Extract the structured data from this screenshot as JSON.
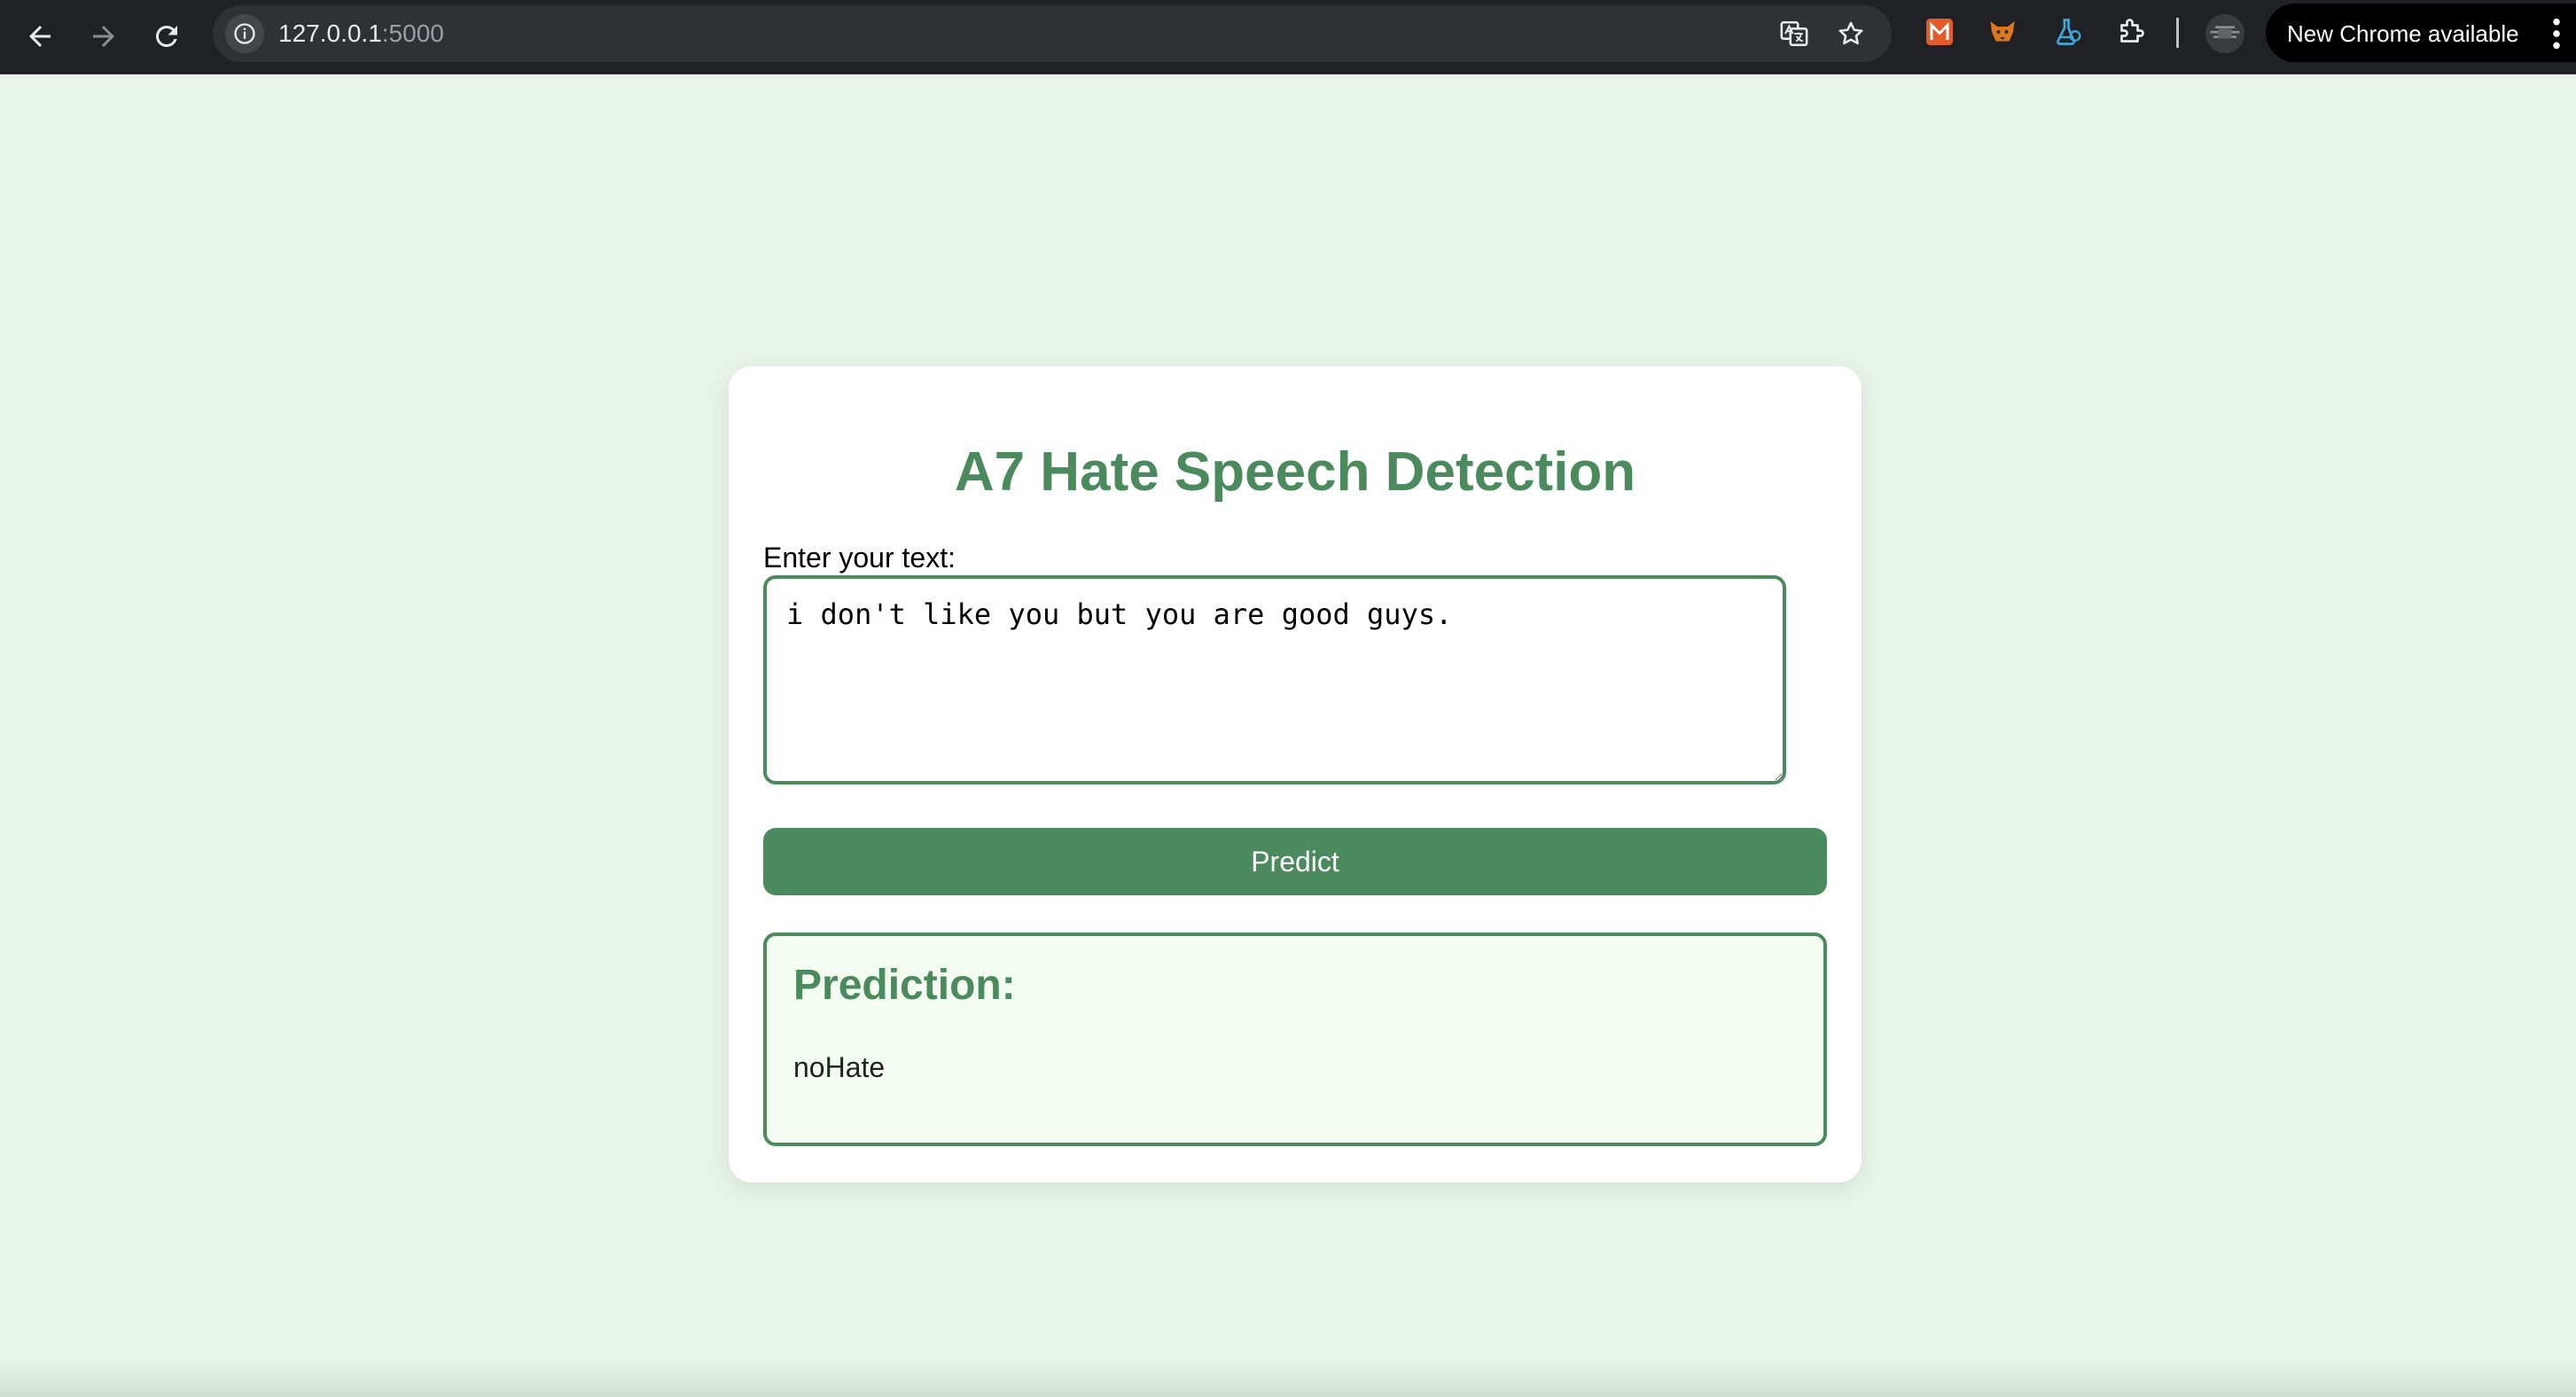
{
  "browser": {
    "url_host": "127.0.0.1",
    "url_port": ":5000",
    "update_label": "New Chrome available"
  },
  "icons": {
    "back": "arrow-left-icon",
    "forward": "arrow-right-icon",
    "reload": "reload-icon",
    "site_info": "info-icon",
    "translate": "translate-icon",
    "bookmark": "star-icon",
    "extensions": [
      "extension-m-icon",
      "extension-fox-icon",
      "extension-flask-icon",
      "puzzle-icon"
    ],
    "menu": "kebab-menu-icon"
  },
  "page": {
    "title": "A7 Hate Speech Detection",
    "input_label": "Enter your text:",
    "input_value": "i don't like you but you are good guys.",
    "predict_label": "Predict",
    "result_heading": "Prediction:",
    "result_value": "noHate"
  },
  "colors": {
    "accent": "#4a8a5c",
    "page_background": "#e8f4e8",
    "result_background": "#f2fcf0",
    "browser_bar": "#202124"
  }
}
